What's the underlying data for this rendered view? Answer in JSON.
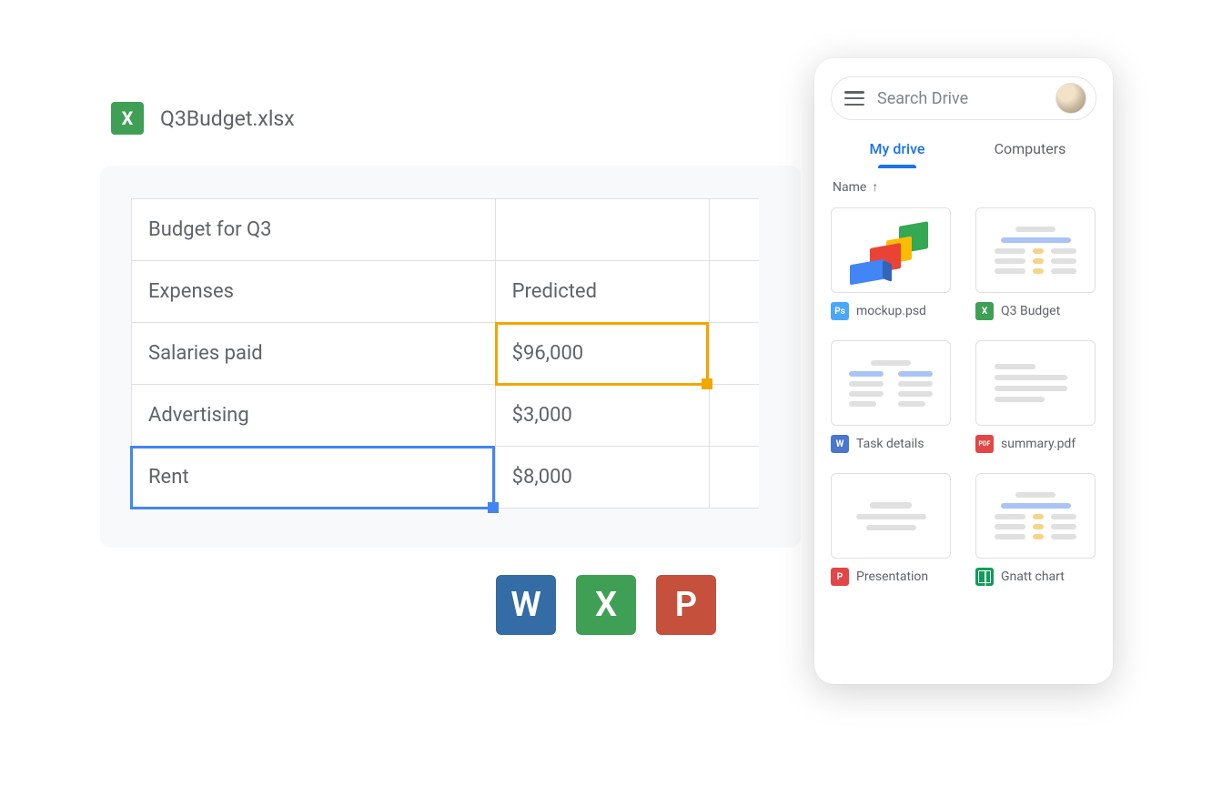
{
  "file": {
    "icon_letter": "X",
    "name": "Q3Budget.xlsx"
  },
  "sheet": {
    "rows": [
      {
        "a": "Budget for Q3",
        "b": ""
      },
      {
        "a": "Expenses",
        "b": "Predicted"
      },
      {
        "a": "Salaries paid",
        "b": "$96,000"
      },
      {
        "a": "Advertising",
        "b": "$3,000"
      },
      {
        "a": "Rent",
        "b": "$8,000"
      }
    ],
    "selection_yellow": {
      "row": 2,
      "col": "b"
    },
    "selection_blue": {
      "row": 4,
      "col": "a"
    }
  },
  "app_icons": {
    "word": "W",
    "excel": "X",
    "ppt": "P"
  },
  "drive": {
    "search_placeholder": "Search Drive",
    "tabs": {
      "active": "My drive",
      "other": "Computers"
    },
    "sort_label": "Name",
    "files": [
      {
        "icon": "ps",
        "icon_text": "Ps",
        "name": "mockup.psd"
      },
      {
        "icon": "excel",
        "icon_text": "X",
        "name": "Q3 Budget"
      },
      {
        "icon": "word",
        "icon_text": "W",
        "name": "Task details"
      },
      {
        "icon": "pdf",
        "icon_text": "PDF",
        "name": "summary.pdf"
      },
      {
        "icon": "ppt",
        "icon_text": "P",
        "name": "Presentation"
      },
      {
        "icon": "sheets",
        "icon_text": "",
        "name": "Gnatt chart"
      }
    ]
  }
}
